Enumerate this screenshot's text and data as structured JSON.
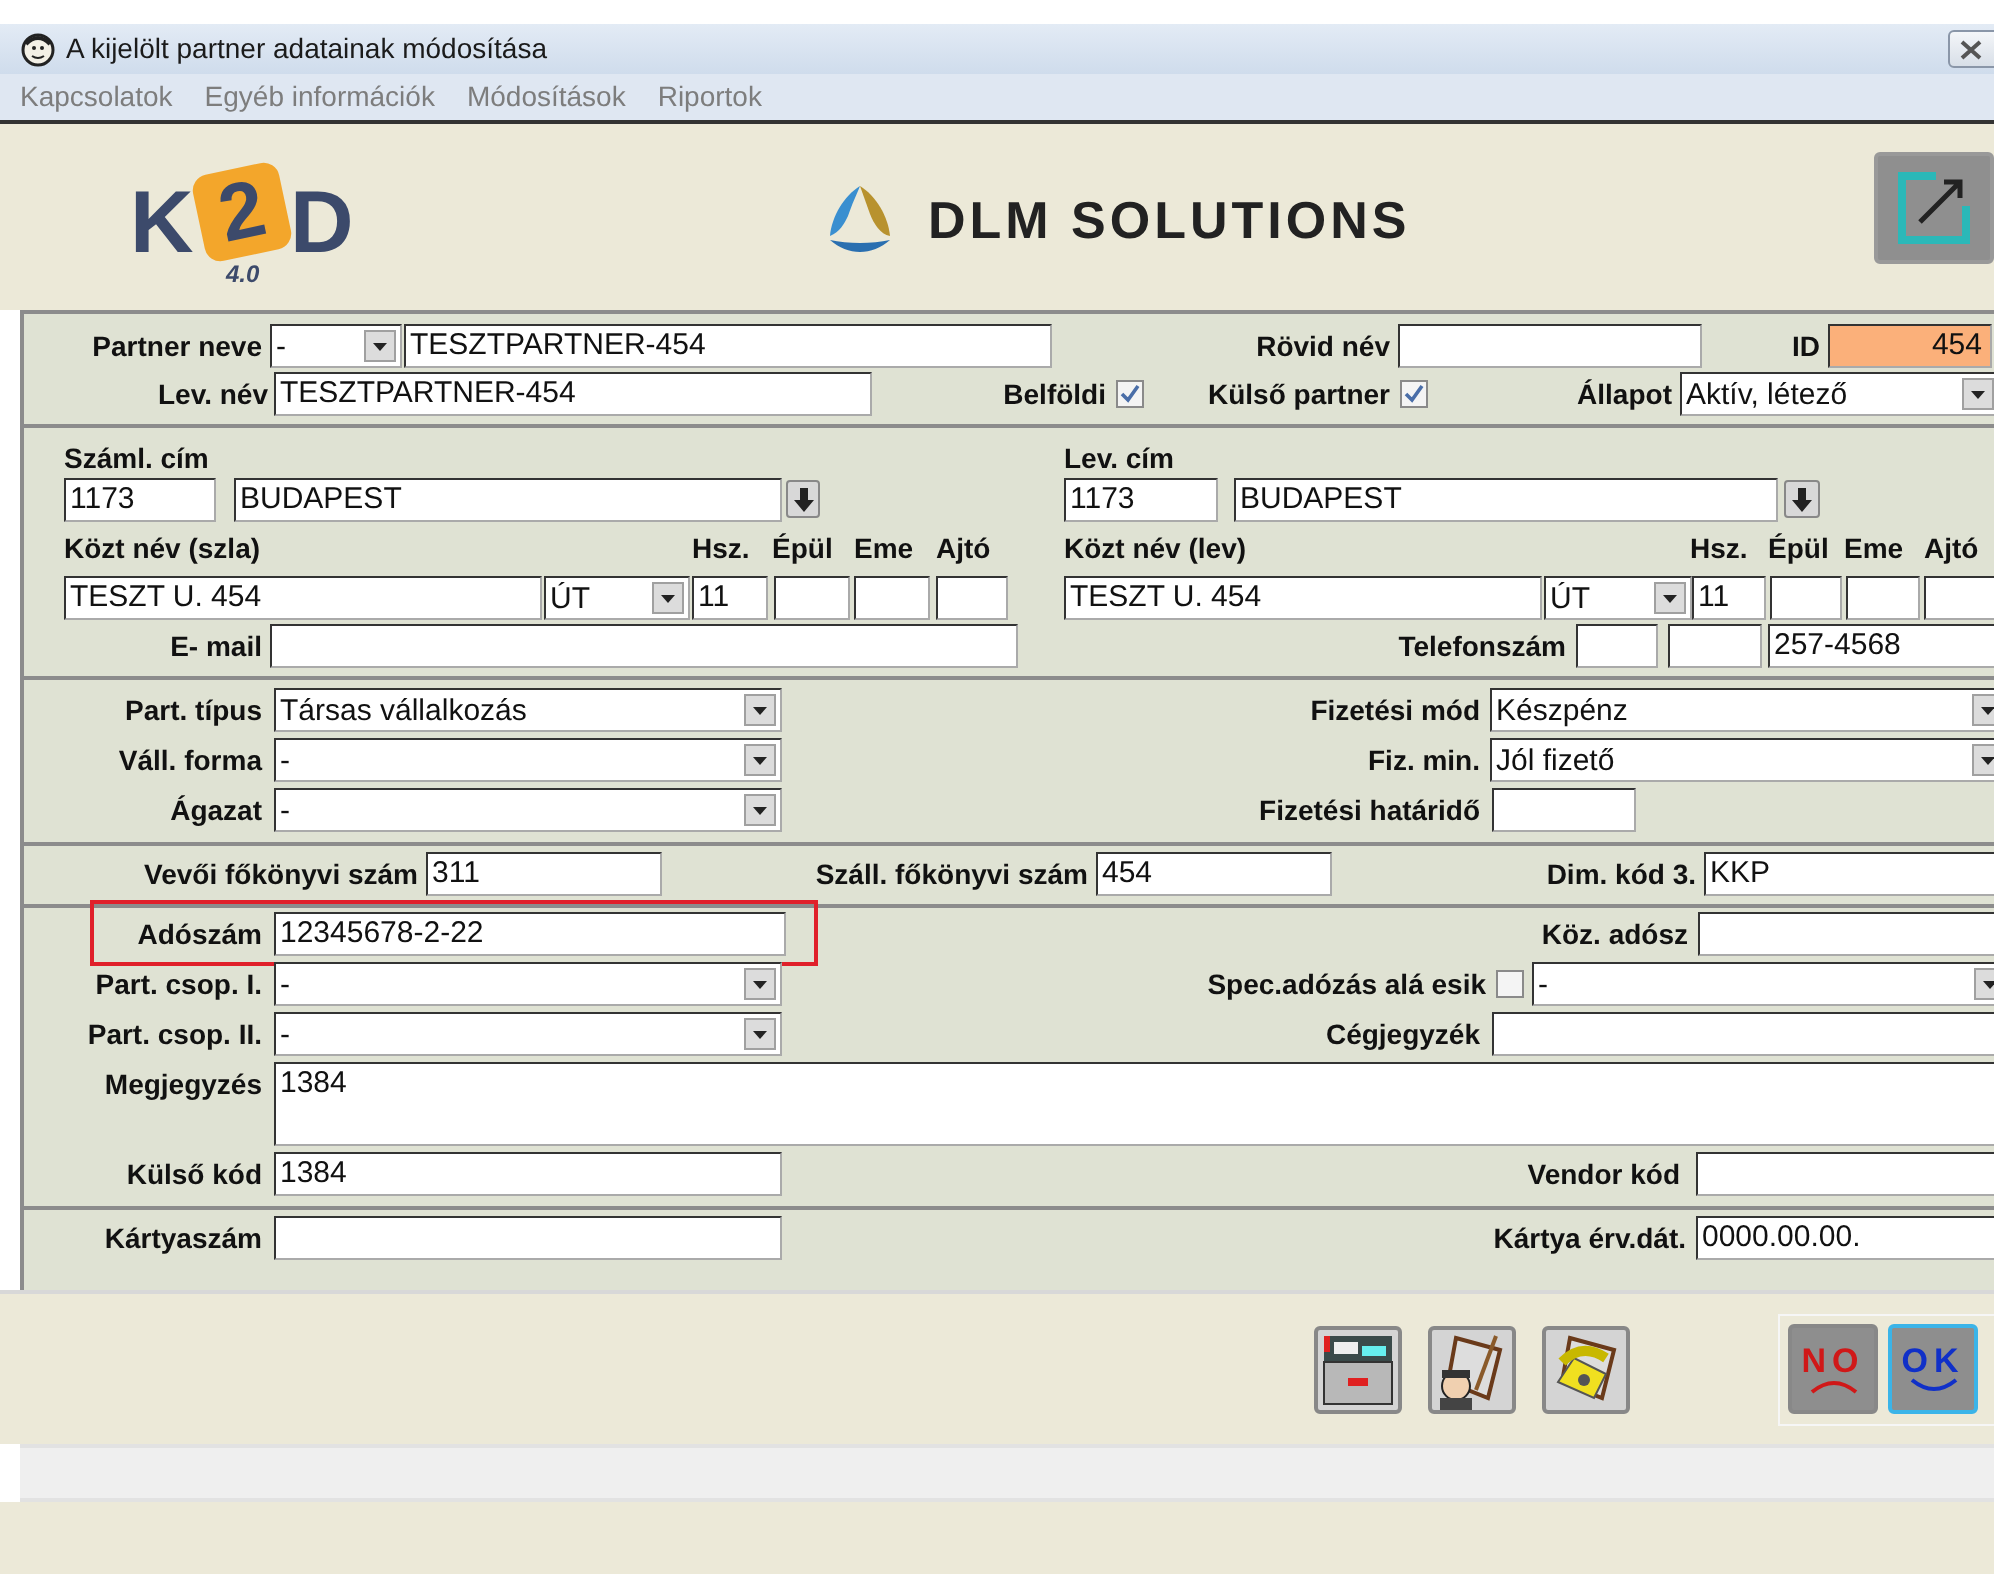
{
  "window": {
    "title": "A kijelölt partner adatainak módosítása"
  },
  "menu": [
    "Kapcsolatok",
    "Egyéb információk",
    "Módosítások",
    "Riportok"
  ],
  "header": {
    "logo": "K2D",
    "version": "4.0",
    "brand": "DLM SOLUTIONS"
  },
  "sections": [
    {
      "rows": [
        {
          "items": [
            {
              "kind": "label",
              "text": "Partner neve"
            },
            {
              "kind": "select",
              "value": "-"
            },
            {
              "kind": "text",
              "value": "TESZTPARTNER-454"
            },
            {
              "kind": "label",
              "text": "Rövid név"
            },
            {
              "kind": "text"
            },
            {
              "kind": "label",
              "text": "ID"
            },
            {
              "kind": "id",
              "value": "454"
            }
          ]
        },
        {
          "items": [
            {
              "kind": "label",
              "text": "Lev. név"
            },
            {
              "kind": "text",
              "value": "TESZTPARTNER-454"
            },
            {
              "kind": "label",
              "text": "Belföldi"
            },
            {
              "kind": "checkbox",
              "checked": true
            },
            {
              "kind": "label",
              "text": "Külső partner"
            },
            {
              "kind": "checkbox",
              "checked": true
            },
            {
              "kind": "label",
              "text": "Állapot"
            },
            {
              "kind": "select",
              "value": "Aktív, létező"
            }
          ]
        }
      ]
    },
    {
      "rows": [
        {
          "items": [
            {
              "kind": "caption",
              "text": "Száml. cím"
            },
            {
              "kind": "caption",
              "text": "Lev. cím"
            }
          ]
        },
        {
          "items": [
            {
              "kind": "text",
              "value": "1173"
            },
            {
              "kind": "text",
              "value": "BUDAPEST"
            },
            {
              "kind": "button"
            },
            {
              "kind": "text",
              "value": "1173"
            },
            {
              "kind": "text",
              "value": "BUDAPEST"
            },
            {
              "kind": "button"
            }
          ]
        },
        {
          "items": [
            {
              "kind": "caption",
              "text": "Közt név (szla)"
            },
            {
              "kind": "caption",
              "text": "Hsz."
            },
            {
              "kind": "caption",
              "text": "Épül"
            },
            {
              "kind": "caption",
              "text": "Eme"
            },
            {
              "kind": "caption",
              "text": "Ajtó"
            },
            {
              "kind": "caption",
              "text": "Közt név (lev)"
            },
            {
              "kind": "caption",
              "text": "Hsz."
            },
            {
              "kind": "caption",
              "text": "Épül"
            },
            {
              "kind": "caption",
              "text": "Eme"
            },
            {
              "kind": "caption",
              "text": "Ajtó"
            }
          ]
        },
        {
          "items": [
            {
              "kind": "text",
              "value": "TESZT U. 454"
            },
            {
              "kind": "select",
              "value": "ÚT"
            },
            {
              "kind": "text",
              "value": "11"
            },
            {
              "kind": "text"
            },
            {
              "kind": "text"
            },
            {
              "kind": "text"
            },
            {
              "kind": "text",
              "value": "TESZT U. 454"
            },
            {
              "kind": "select",
              "value": "ÚT"
            },
            {
              "kind": "text",
              "value": "11"
            },
            {
              "kind": "text"
            },
            {
              "kind": "text"
            },
            {
              "kind": "text"
            }
          ]
        },
        {
          "items": [
            {
              "kind": "label",
              "text": "E- mail"
            },
            {
              "kind": "text"
            },
            {
              "kind": "label",
              "text": "Telefonszám"
            },
            {
              "kind": "text"
            },
            {
              "kind": "text"
            },
            {
              "kind": "text",
              "value": "257-4568"
            }
          ]
        }
      ]
    },
    {
      "rows": [
        {
          "items": [
            {
              "kind": "label",
              "text": "Part. típus"
            },
            {
              "kind": "select",
              "value": "Társas vállalkozás"
            },
            {
              "kind": "label",
              "text": "Fizetési mód"
            },
            {
              "kind": "select",
              "value": "Készpénz"
            }
          ]
        },
        {
          "items": [
            {
              "kind": "label",
              "text": "Váll. forma"
            },
            {
              "kind": "select",
              "value": "-"
            },
            {
              "kind": "label",
              "text": "Fiz. min."
            },
            {
              "kind": "select",
              "value": "Jól fizető"
            }
          ]
        },
        {
          "items": [
            {
              "kind": "label",
              "text": "Ágazat"
            },
            {
              "kind": "select",
              "value": "-"
            },
            {
              "kind": "label",
              "text": "Fizetési határidő"
            },
            {
              "kind": "text"
            }
          ]
        }
      ]
    },
    {
      "rows": [
        {
          "items": [
            {
              "kind": "label",
              "text": "Vevői főkönyvi szám"
            },
            {
              "kind": "text",
              "value": "311"
            },
            {
              "kind": "label",
              "text": "Száll. főkönyvi szám"
            },
            {
              "kind": "text",
              "value": "454"
            },
            {
              "kind": "label",
              "text": "Dim. kód 3."
            },
            {
              "kind": "text",
              "value": "KKP"
            }
          ]
        }
      ]
    },
    {
      "rows": [
        {
          "highlighted": true,
          "items": [
            {
              "kind": "label",
              "text": "Adószám"
            },
            {
              "kind": "text",
              "value": "12345678-2-22"
            },
            {
              "kind": "label",
              "text": "Köz. adósz"
            },
            {
              "kind": "text"
            }
          ]
        },
        {
          "items": [
            {
              "kind": "label",
              "text": "Part. csop. I."
            },
            {
              "kind": "select",
              "value": "-"
            },
            {
              "kind": "label",
              "text": "Spec.adózás alá esik"
            },
            {
              "kind": "checkbox",
              "checked": false
            },
            {
              "kind": "select",
              "value": "-"
            }
          ]
        },
        {
          "items": [
            {
              "kind": "label",
              "text": "Part. csop. II."
            },
            {
              "kind": "select",
              "value": "-"
            },
            {
              "kind": "label",
              "text": "Cégjegyzék"
            },
            {
              "kind": "text"
            }
          ]
        },
        {
          "items": [
            {
              "kind": "label",
              "text": "Megjegyzés"
            },
            {
              "kind": "textarea",
              "value": "1384"
            }
          ]
        },
        {
          "items": [
            {
              "kind": "label",
              "text": "Külső kód"
            },
            {
              "kind": "text",
              "value": "1384"
            },
            {
              "kind": "label",
              "text": "Vendor kód"
            },
            {
              "kind": "text"
            }
          ]
        }
      ]
    },
    {
      "rows": [
        {
          "items": [
            {
              "kind": "label",
              "text": "Kártyaszám"
            },
            {
              "kind": "text"
            },
            {
              "kind": "label",
              "text": "Kártya érv.dát."
            },
            {
              "kind": "text",
              "value": "0000.00.00."
            }
          ]
        }
      ]
    }
  ],
  "dialog_buttons": [
    {
      "label": "NO",
      "focused": false
    },
    {
      "label": "OK",
      "focused": true
    }
  ]
}
